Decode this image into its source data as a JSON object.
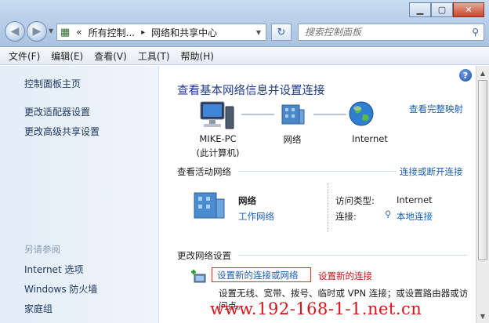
{
  "window": {
    "minimize_icon": "minimize-icon",
    "maximize_icon": "maximize-icon",
    "close_icon": "close-icon"
  },
  "nav": {
    "address_segments": [
      "«",
      "所有控制...",
      "▸",
      "网络和共享中心"
    ],
    "search_placeholder": "搜索控制面板"
  },
  "menu": [
    "文件(F)",
    "编辑(E)",
    "查看(V)",
    "工具(T)",
    "帮助(H)"
  ],
  "sidebar": {
    "links": [
      "控制面板主页",
      "更改适配器设置",
      "更改高级共享设置"
    ],
    "see_also_heading": "另请参阅",
    "see_also": [
      "Internet 选项",
      "Windows 防火墙",
      "家庭组"
    ]
  },
  "main": {
    "title": "查看基本网络信息并设置连接",
    "view_full_map": "查看完整映射",
    "nodes": {
      "pc_name": "MIKE-PC",
      "pc_sub": "(此计算机)",
      "network": "网络",
      "internet": "Internet"
    },
    "active_title": "查看活动网络",
    "connect_disconnect": "连接或断开连接",
    "network_name": "网络",
    "network_type": "工作网络",
    "access_type_label": "访问类型:",
    "access_type_value": "Internet",
    "connection_label": "连接:",
    "connection_value": "本地连接",
    "change_title": "更改网络设置",
    "setup_link": "设置新的连接或网络",
    "setup_note": "设置新的连接",
    "setup_desc": "设置无线、宽带、拨号、临时或 VPN 连接；或设置路由器或访问点。"
  },
  "watermark": "www.192-168-1-1.net.cn"
}
